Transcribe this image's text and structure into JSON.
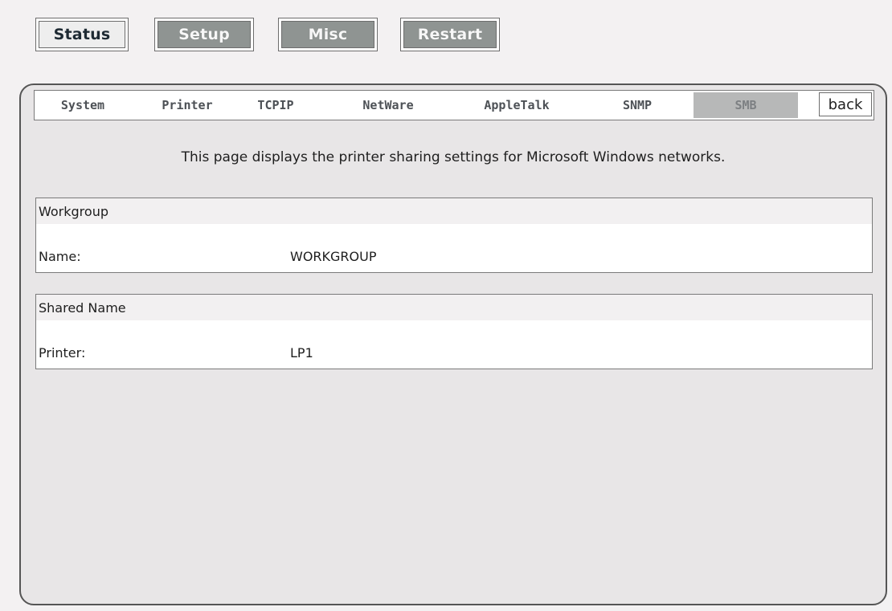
{
  "topnav": {
    "status": "Status",
    "setup": "Setup",
    "misc": "Misc",
    "restart": "Restart"
  },
  "tabs": {
    "system": "System",
    "printer": "Printer",
    "tcpip": "TCPIP",
    "netware": "NetWare",
    "appletalk": "AppleTalk",
    "snmp": "SNMP",
    "smb": "SMB",
    "back": "back",
    "active": "SMB"
  },
  "description": "This page displays the printer sharing settings for Microsoft Windows networks.",
  "workgroup": {
    "heading": "Workgroup",
    "name_label": "Name:",
    "name_value": "WORKGROUP"
  },
  "shared_name": {
    "heading": "Shared Name",
    "printer_label": "Printer:",
    "printer_value": "LP1"
  },
  "colors": {
    "page_background": "#f3f1f2",
    "panel_background": "#e8e6e7",
    "active_tab": "#b7b8b8",
    "dark_button": "#8f9492"
  }
}
